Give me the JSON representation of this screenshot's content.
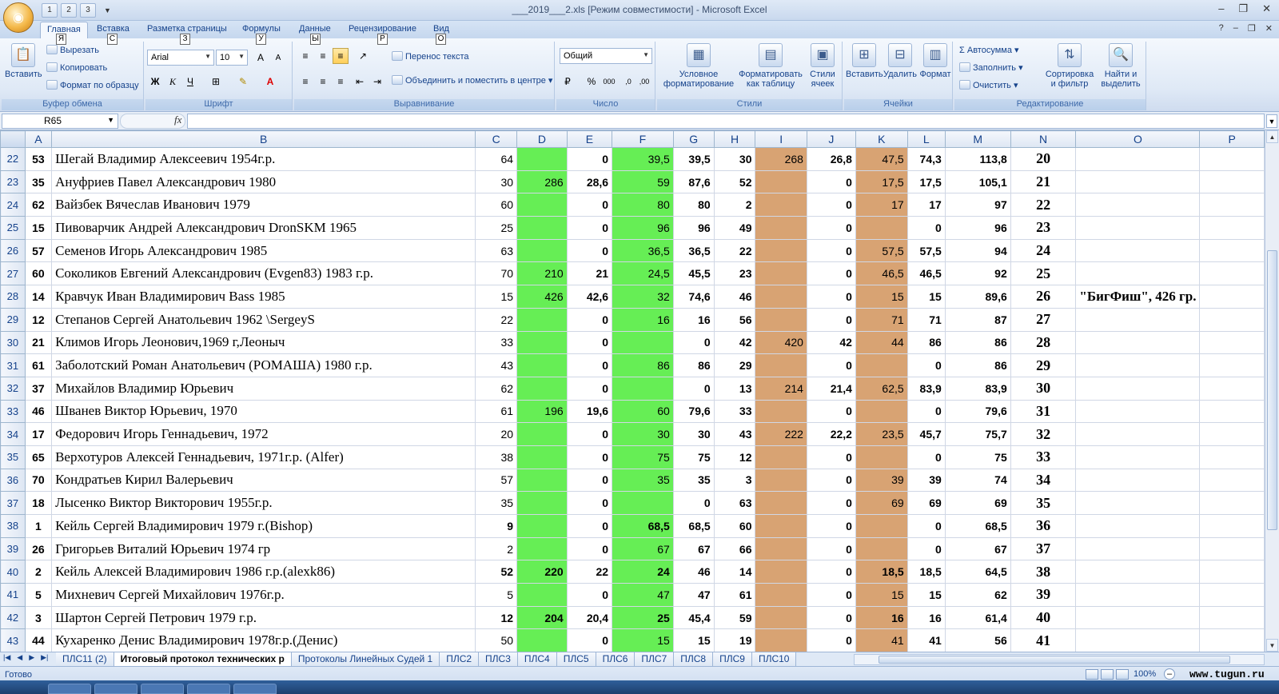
{
  "window": {
    "title": "___2019___2.xls  [Режим совместимости] - Microsoft Excel",
    "qat": [
      "1",
      "2",
      "3"
    ]
  },
  "tabs": [
    {
      "label": "Главная",
      "keytip": "Я"
    },
    {
      "label": "Вставка",
      "keytip": "С"
    },
    {
      "label": "Разметка страницы",
      "keytip": "З"
    },
    {
      "label": "Формулы",
      "keytip": "У"
    },
    {
      "label": "Данные",
      "keytip": "Ы"
    },
    {
      "label": "Рецензирование",
      "keytip": "Р"
    },
    {
      "label": "Вид",
      "keytip": "О"
    }
  ],
  "ribbon": {
    "clipboard": {
      "label": "Буфер обмена",
      "paste": "Вставить",
      "cut": "Вырезать",
      "copy": "Копировать",
      "format_painter": "Формат по образцу"
    },
    "font": {
      "label": "Шрифт",
      "name": "Arial",
      "size": "10"
    },
    "alignment": {
      "label": "Выравнивание",
      "wrap": "Перенос текста",
      "merge": "Объединить и поместить в центре"
    },
    "number": {
      "label": "Число",
      "format": "Общий",
      "percent": "%",
      "thousands": "000"
    },
    "styles": {
      "label": "Стили",
      "conditional": "Условное форматирование",
      "as_table": "Форматировать как таблицу",
      "cell_styles": "Стили ячеек"
    },
    "cells": {
      "label": "Ячейки",
      "insert": "Вставить",
      "delete": "Удалить",
      "format": "Формат"
    },
    "editing": {
      "label": "Редактирование",
      "autosum": "Автосумма",
      "fill": "Заполнить",
      "clear": "Очистить",
      "sort": "Сортировка и фильтр",
      "find": "Найти и выделить"
    }
  },
  "formula_bar": {
    "name_box": "R65",
    "fx": "fx",
    "content": ""
  },
  "columns": [
    "A",
    "B",
    "C",
    "D",
    "E",
    "F",
    "G",
    "H",
    "I",
    "J",
    "K",
    "L",
    "M",
    "N",
    "O",
    "P"
  ],
  "rows": [
    {
      "r": "22",
      "a": "53",
      "b": "Шегай Владимир Алексеевич 1954г.р.",
      "c": "64",
      "d": "",
      "e": "0",
      "f": "39,5",
      "g": "39,5",
      "h": "30",
      "i": "268",
      "j": "26,8",
      "k": "47,5",
      "l": "74,3",
      "m": "113,8",
      "n": "20",
      "o": ""
    },
    {
      "r": "23",
      "a": "35",
      "b": "Ануфриев Павел Александрович 1980",
      "c": "30",
      "d": "286",
      "e": "28,6",
      "f": "59",
      "g": "87,6",
      "h": "52",
      "i": "",
      "j": "0",
      "k": "17,5",
      "l": "17,5",
      "m": "105,1",
      "n": "21",
      "o": ""
    },
    {
      "r": "24",
      "a": "62",
      "b": "Вайзбек Вячеслав Иванович 1979",
      "c": "60",
      "d": "",
      "e": "0",
      "f": "80",
      "g": "80",
      "h": "2",
      "i": "",
      "j": "0",
      "k": "17",
      "l": "17",
      "m": "97",
      "n": "22",
      "o": ""
    },
    {
      "r": "25",
      "a": "15",
      "b": "Пивоварчик Андрей Александрович DronSKM 1965",
      "c": "25",
      "d": "",
      "e": "0",
      "f": "96",
      "g": "96",
      "h": "49",
      "i": "",
      "j": "0",
      "k": "",
      "l": "0",
      "m": "96",
      "n": "23",
      "o": ""
    },
    {
      "r": "26",
      "a": "57",
      "b": "Семенов Игорь Александрович 1985",
      "c": "63",
      "d": "",
      "e": "0",
      "f": "36,5",
      "g": "36,5",
      "h": "22",
      "i": "",
      "j": "0",
      "k": "57,5",
      "l": "57,5",
      "m": "94",
      "n": "24",
      "o": ""
    },
    {
      "r": "27",
      "a": "60",
      "b": "Соколиков Евгений Александрович (Evgen83) 1983 г.р.",
      "c": "70",
      "d": "210",
      "e": "21",
      "f": "24,5",
      "g": "45,5",
      "h": "23",
      "i": "",
      "j": "0",
      "k": "46,5",
      "l": "46,5",
      "m": "92",
      "n": "25",
      "o": ""
    },
    {
      "r": "28",
      "a": "14",
      "b": "Кравчук Иван Владимирович Bass 1985",
      "c": "15",
      "d": "426",
      "e": "42,6",
      "f": "32",
      "g": "74,6",
      "h": "46",
      "i": "",
      "j": "0",
      "k": "15",
      "l": "15",
      "m": "89,6",
      "n": "26",
      "o": "\"БигФиш\", 426 гр."
    },
    {
      "r": "29",
      "a": "12",
      "b": "Степанов Сергей Анатольевич 1962 \\SergeyS",
      "c": "22",
      "d": "",
      "e": "0",
      "f": "16",
      "g": "16",
      "h": "56",
      "i": "",
      "j": "0",
      "k": "71",
      "l": "71",
      "m": "87",
      "n": "27",
      "o": ""
    },
    {
      "r": "30",
      "a": "21",
      "b": "Климов Игорь Леонович,1969 г,Леоныч",
      "c": "33",
      "d": "",
      "e": "0",
      "f": "",
      "g": "0",
      "h": "42",
      "i": "420",
      "j": "42",
      "k": "44",
      "l": "86",
      "m": "86",
      "n": "28",
      "o": ""
    },
    {
      "r": "31",
      "a": "61",
      "b": "Заболотский Роман Анатольевич (РОМАША) 1980 г.р.",
      "c": "43",
      "d": "",
      "e": "0",
      "f": "86",
      "g": "86",
      "h": "29",
      "i": "",
      "j": "0",
      "k": "",
      "l": "0",
      "m": "86",
      "n": "29",
      "o": ""
    },
    {
      "r": "32",
      "a": "37",
      "b": "Михайлов Владимир Юрьевич",
      "c": "62",
      "d": "",
      "e": "0",
      "f": "",
      "g": "0",
      "h": "13",
      "i": "214",
      "j": "21,4",
      "k": "62,5",
      "l": "83,9",
      "m": "83,9",
      "n": "30",
      "o": ""
    },
    {
      "r": "33",
      "a": "46",
      "b": "Шванев Виктор Юрьевич, 1970",
      "c": "61",
      "d": "196",
      "e": "19,6",
      "f": "60",
      "g": "79,6",
      "h": "33",
      "i": "",
      "j": "0",
      "k": "",
      "l": "0",
      "m": "79,6",
      "n": "31",
      "o": ""
    },
    {
      "r": "34",
      "a": "17",
      "b": "Федорович Игорь Геннадьевич, 1972",
      "c": "20",
      "d": "",
      "e": "0",
      "f": "30",
      "g": "30",
      "h": "43",
      "i": "222",
      "j": "22,2",
      "k": "23,5",
      "l": "45,7",
      "m": "75,7",
      "n": "32",
      "o": ""
    },
    {
      "r": "35",
      "a": "65",
      "b": "Верхотуров Алексей Геннадьевич, 1971г.р. (Alfer)",
      "c": "38",
      "d": "",
      "e": "0",
      "f": "75",
      "g": "75",
      "h": "12",
      "i": "",
      "j": "0",
      "k": "",
      "l": "0",
      "m": "75",
      "n": "33",
      "o": ""
    },
    {
      "r": "36",
      "a": "70",
      "b": "Кондратьев Кирил Валерьевич",
      "c": "57",
      "d": "",
      "e": "0",
      "f": "35",
      "g": "35",
      "h": "3",
      "i": "",
      "j": "0",
      "k": "39",
      "l": "39",
      "m": "74",
      "n": "34",
      "o": ""
    },
    {
      "r": "37",
      "a": "18",
      "b": "Лысенко Виктор Викторович 1955г.р.",
      "c": "35",
      "d": "",
      "e": "0",
      "f": "",
      "g": "0",
      "h": "63",
      "i": "",
      "j": "0",
      "k": "69",
      "l": "69",
      "m": "69",
      "n": "35",
      "o": ""
    },
    {
      "r": "38",
      "a": "1",
      "b": "Кейль Сергей Владимирович 1979 г.(Bishop)",
      "c": "9",
      "d": "",
      "e": "0",
      "f": "68,5",
      "g": "68,5",
      "h": "60",
      "i": "",
      "j": "0",
      "k": "",
      "l": "0",
      "m": "68,5",
      "n": "36",
      "o": ""
    },
    {
      "r": "39",
      "a": "26",
      "b": "Григорьев Виталий Юрьевич 1974 гр",
      "c": "2",
      "d": "",
      "e": "0",
      "f": "67",
      "g": "67",
      "h": "66",
      "i": "",
      "j": "0",
      "k": "",
      "l": "0",
      "m": "67",
      "n": "37",
      "o": ""
    },
    {
      "r": "40",
      "a": "2",
      "b": "Кейль Алексей Владимирович 1986 г.р.(alexk86)",
      "c": "52",
      "d": "220",
      "e": "22",
      "f": "24",
      "g": "46",
      "h": "14",
      "i": "",
      "j": "0",
      "k": "18,5",
      "l": "18,5",
      "m": "64,5",
      "n": "38",
      "o": ""
    },
    {
      "r": "41",
      "a": "5",
      "b": "Михневич Сергей Михайлович 1976г.р.",
      "c": "5",
      "d": "",
      "e": "0",
      "f": "47",
      "g": "47",
      "h": "61",
      "i": "",
      "j": "0",
      "k": "15",
      "l": "15",
      "m": "62",
      "n": "39",
      "o": ""
    },
    {
      "r": "42",
      "a": "3",
      "b": "Шартон Сергей Петрович 1979 г.р.",
      "c": "12",
      "d": "204",
      "e": "20,4",
      "f": "25",
      "g": "45,4",
      "h": "59",
      "i": "",
      "j": "0",
      "k": "16",
      "l": "16",
      "m": "61,4",
      "n": "40",
      "o": ""
    },
    {
      "r": "43",
      "a": "44",
      "b": "Кухаренко Денис Владимирович 1978г.р.(Денис)",
      "c": "50",
      "d": "",
      "e": "0",
      "f": "15",
      "g": "15",
      "h": "19",
      "i": "",
      "j": "0",
      "k": "41",
      "l": "41",
      "m": "56",
      "n": "41",
      "o": ""
    }
  ],
  "sheet_tabs": [
    "ПЛС11 (2)",
    "Итоговый протокол технических р",
    "Протоколы Линейных Судей 1",
    "ПЛС2",
    "ПЛС3",
    "ПЛС4",
    "ПЛС5",
    "ПЛС6",
    "ПЛС7",
    "ПЛС8",
    "ПЛС9",
    "ПЛС10"
  ],
  "active_sheet_index": 1,
  "status": {
    "ready": "Готово",
    "zoom": "100%",
    "watermark": "www.tugun.ru"
  },
  "colors": {
    "green_fill": "#66ee55",
    "tan_fill": "#d8a373",
    "header_text": "#15428b"
  }
}
